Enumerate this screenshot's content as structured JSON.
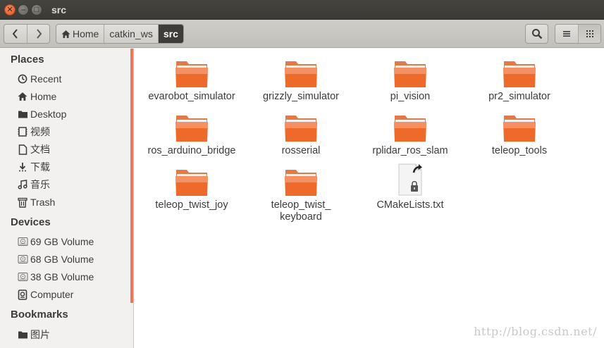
{
  "window": {
    "title": "src"
  },
  "toolbar": {
    "back_icon": "chevron-left-icon",
    "forward_icon": "chevron-right-icon",
    "breadcrumbs": [
      "Home",
      "catkin_ws",
      "src"
    ],
    "search_icon": "search-icon",
    "list_view_icon": "list-view-icon",
    "grid_view_icon": "grid-view-icon"
  },
  "sidebar": {
    "places_header": "Places",
    "places": [
      {
        "label": "Recent",
        "icon": "clock-icon"
      },
      {
        "label": "Home",
        "icon": "home-icon"
      },
      {
        "label": "Desktop",
        "icon": "folder-icon"
      },
      {
        "label": "视频",
        "icon": "film-icon"
      },
      {
        "label": "文档",
        "icon": "document-icon"
      },
      {
        "label": "下载",
        "icon": "download-icon"
      },
      {
        "label": "音乐",
        "icon": "music-icon"
      },
      {
        "label": "Trash",
        "icon": "trash-icon"
      }
    ],
    "devices_header": "Devices",
    "devices": [
      {
        "label": "69 GB Volume",
        "icon": "drive-icon"
      },
      {
        "label": "68 GB Volume",
        "icon": "drive-icon"
      },
      {
        "label": "38 GB Volume",
        "icon": "drive-icon"
      },
      {
        "label": "Computer",
        "icon": "computer-icon"
      }
    ],
    "bookmarks_header": "Bookmarks",
    "bookmarks": [
      {
        "label": "图片",
        "icon": "folder-icon"
      }
    ]
  },
  "files": [
    {
      "name": "evarobot_simulator",
      "type": "folder"
    },
    {
      "name": "grizzly_simulator",
      "type": "folder"
    },
    {
      "name": "pi_vision",
      "type": "folder"
    },
    {
      "name": "pr2_simulator",
      "type": "folder"
    },
    {
      "name": "ros_arduino_bridge",
      "type": "folder"
    },
    {
      "name": "rosserial",
      "type": "folder"
    },
    {
      "name": "rplidar_ros_slam",
      "type": "folder"
    },
    {
      "name": "teleop_tools",
      "type": "folder"
    },
    {
      "name": "teleop_twist_joy",
      "type": "folder"
    },
    {
      "name_line1": "teleop_twist_",
      "name_line2": "keyboard",
      "type": "folder"
    },
    {
      "name": "CMakeLists.txt",
      "type": "text-file-locked-link"
    }
  ],
  "watermark": "http://blog.csdn.net/",
  "colors": {
    "accent": "#e9795a",
    "folder": "#e8622b",
    "titlebar": "#3c3b37"
  }
}
